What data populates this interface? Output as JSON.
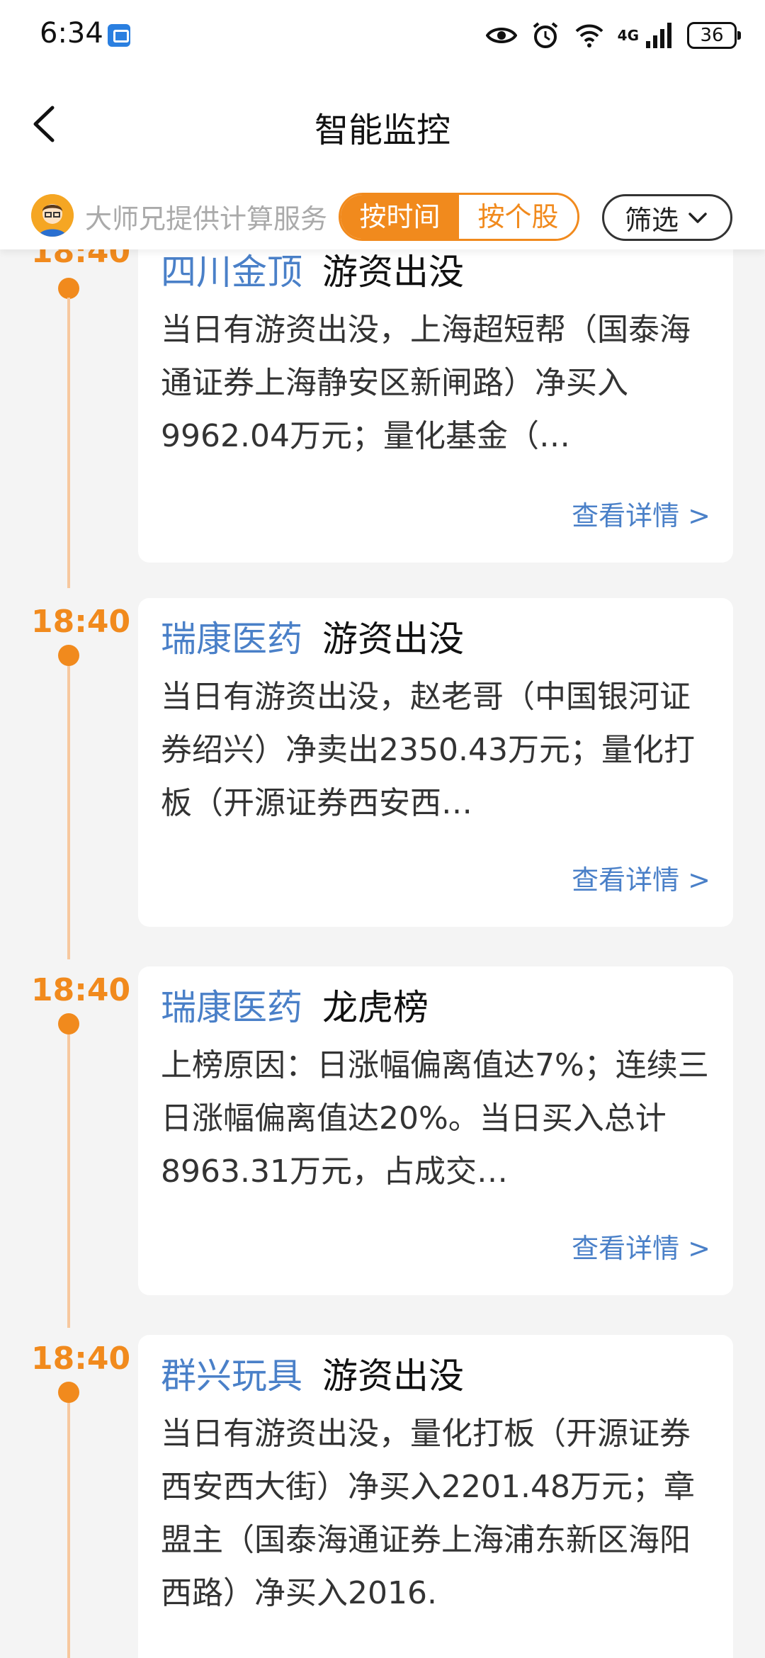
{
  "status_bar": {
    "time": "6:34",
    "network": "4G",
    "battery": "36"
  },
  "header": {
    "title": "智能监控"
  },
  "filter_bar": {
    "provider_text": "大师兄提供计算服务",
    "tab_time": "按时间",
    "tab_stock": "按个股",
    "filter_label": "筛选"
  },
  "feed": [
    {
      "time": "18:40",
      "stock": "四川金顶",
      "type": "游资出没",
      "body": "当日有游资出没，上海超短帮（国泰海通证券上海静安区新闸路）净买入9962.04万元；量化基金（…",
      "detail": "查看详情 >"
    },
    {
      "time": "18:40",
      "stock": "瑞康医药",
      "type": "游资出没",
      "body": "当日有游资出没，赵老哥（中国银河证券绍兴）净卖出2350.43万元；量化打板（开源证券西安西…",
      "detail": "查看详情 >"
    },
    {
      "time": "18:40",
      "stock": "瑞康医药",
      "type": "龙虎榜",
      "body": "上榜原因：日涨幅偏离值达7%；连续三日涨幅偏离值达20%。当日买入总计8963.31万元，占成交…",
      "detail": "查看详情 >"
    },
    {
      "time": "18:40",
      "stock": "群兴玩具",
      "type": "游资出没",
      "body": "当日有游资出没，量化打板（开源证券西安西大街）净买入2201.48万元；章盟主（国泰海通证券上海浦东新区海阳西路）净买入2016.",
      "detail": ""
    }
  ]
}
